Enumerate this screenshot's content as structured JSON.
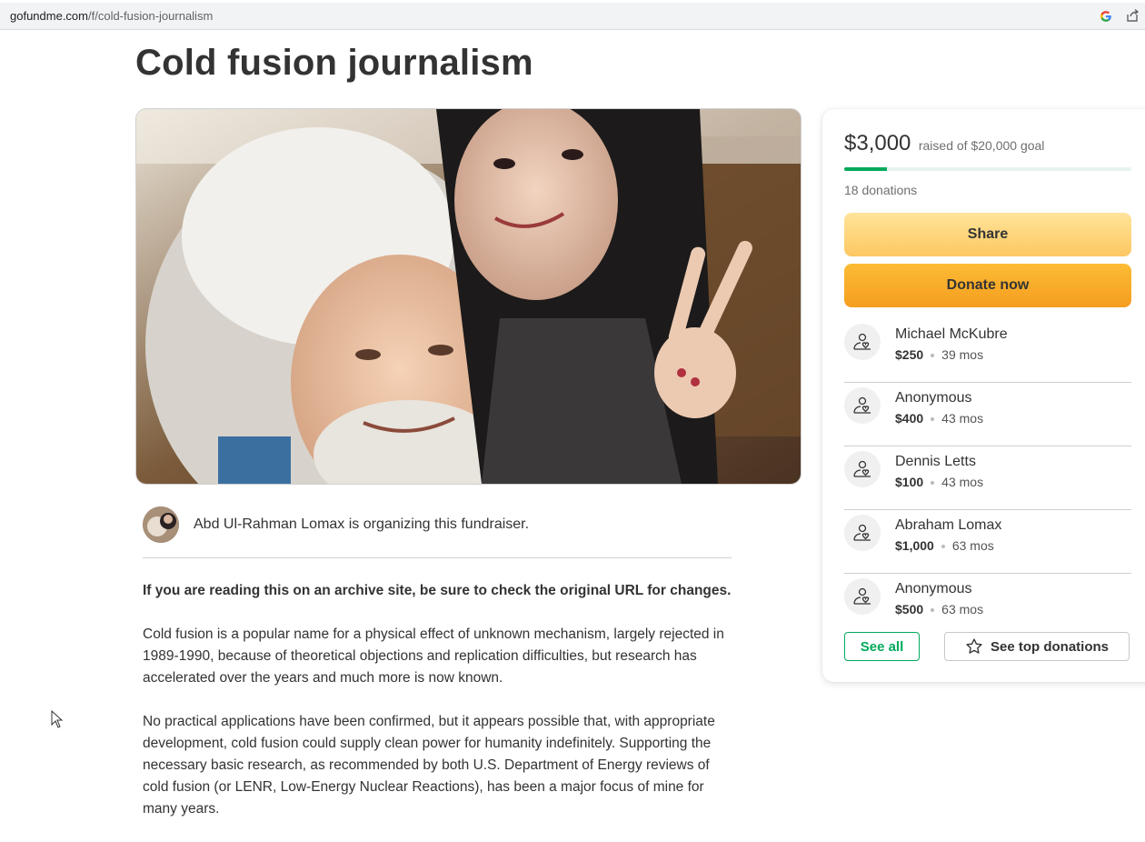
{
  "browser": {
    "url_host": "gofundme.com",
    "url_path": "/f/cold-fusion-journalism",
    "icons": [
      "google-icon",
      "share-page-icon"
    ]
  },
  "page": {
    "title": "Cold fusion journalism"
  },
  "organizer": {
    "text": "Abd Ul-Rahman Lomax is organizing this fundraiser."
  },
  "story": {
    "paragraphs": [
      "If you are reading this on an archive site, be sure to check the original URL for changes.",
      "Cold fusion is a popular name for a physical effect of unknown mechanism, largely rejected in 1989-1990, because of theoretical objections and replication difficulties, but research has accelerated over the years and much more is now known.",
      "No practical applications have been confirmed, but it appears possible that, with appropriate development, cold fusion could supply clean power for humanity indefinitely.  Supporting the necessary basic research, as recommended by both U.S. Department of Energy reviews of cold fusion (or LENR, Low-Energy Nuclear Reactions), has been a major focus of mine for many years."
    ]
  },
  "donation_card": {
    "raised": "$3,000",
    "goal_text": "raised of $20,000 goal",
    "progress_fraction": 0.15,
    "donation_count": "18 donations",
    "share_label": "Share",
    "donate_label": "Donate now",
    "donors": [
      {
        "name": "Michael McKubre",
        "amount": "$250",
        "time": "39 mos"
      },
      {
        "name": "Anonymous",
        "amount": "$400",
        "time": "43 mos"
      },
      {
        "name": "Dennis Letts",
        "amount": "$100",
        "time": "43 mos"
      },
      {
        "name": "Abraham Lomax",
        "amount": "$1,000",
        "time": "63 mos"
      },
      {
        "name": "Anonymous",
        "amount": "$500",
        "time": "63 mos"
      }
    ],
    "see_all_label": "See all",
    "see_top_label": "See top donations"
  },
  "colors": {
    "accent_green": "#02a95c",
    "donate_orange": "#f59d1f",
    "share_yellow": "#fdc762"
  }
}
